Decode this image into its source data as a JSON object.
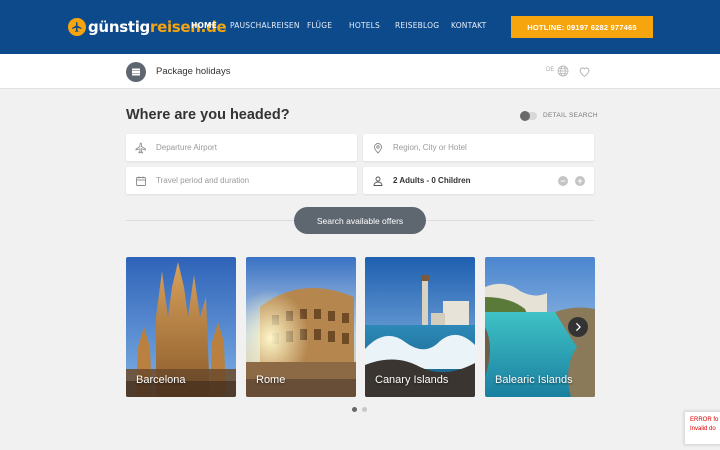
{
  "brand": {
    "name_part1": "günstig",
    "name_part2": "reisen.de",
    "accent_color": "#f6a50f",
    "primary_color": "#0d4a8c"
  },
  "nav": {
    "items": [
      {
        "label": "HOME",
        "active": true
      },
      {
        "label": "PAUSCHALREISEN",
        "active": false
      },
      {
        "label": "FLÜGE",
        "active": false
      },
      {
        "label": "HOTELS",
        "active": false
      },
      {
        "label": "REISEBLOG",
        "active": false
      },
      {
        "label": "KONTAKT",
        "active": false
      }
    ],
    "hotline": "HOTLINE: 09197 6282 977465"
  },
  "subbar": {
    "menu_icon": "hamburger-icon",
    "title": "Package holidays",
    "language": "DE",
    "globe_icon": "globe-icon",
    "favorites_icon": "heart-icon"
  },
  "search": {
    "headline": "Where are you headed?",
    "detail_search_label": "DETAIL SEARCH",
    "detail_search_enabled": false,
    "departure": {
      "placeholder": "Departure Airport",
      "icon": "plane-icon"
    },
    "destination": {
      "placeholder": "Region, City or Hotel",
      "icon": "map-pin-icon"
    },
    "travel_period": {
      "placeholder": "Travel period and duration",
      "icon": "calendar-icon"
    },
    "travellers": {
      "value": "2 Adults - 0 Children",
      "icon": "person-icon",
      "decrement": "−",
      "increment": "+"
    },
    "submit_label": "Search available offers"
  },
  "destinations": [
    {
      "name": "Barcelona"
    },
    {
      "name": "Rome"
    },
    {
      "name": "Canary Islands"
    },
    {
      "name": "Balearic Islands"
    }
  ],
  "carousel": {
    "next_icon": "chevron-right-icon",
    "pages": 2,
    "current_page": 1
  },
  "recaptcha": {
    "error": "ERROR fo",
    "message": "Invalid do"
  }
}
